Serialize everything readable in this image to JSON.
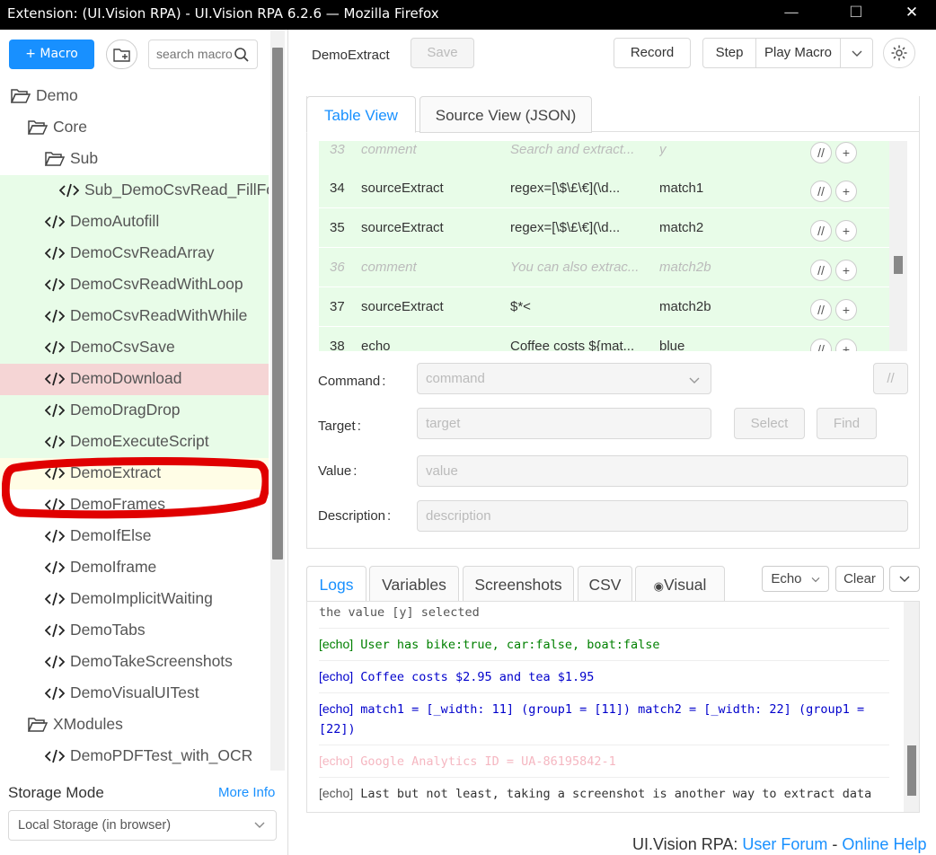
{
  "window": {
    "title": "Extension: (UI.Vision RPA) - UI.Vision RPA 6.2.6 — Mozilla Firefox",
    "minimize_glyph": "—",
    "maximize_glyph": "☐",
    "close_glyph": "✕"
  },
  "sidebar": {
    "new_macro_label": "+ Macro",
    "search_placeholder": "search macro",
    "tree": [
      {
        "label": "Demo",
        "type": "folder",
        "level": 0,
        "state": "normal"
      },
      {
        "label": "Core",
        "type": "folder",
        "level": 1,
        "state": "normal"
      },
      {
        "label": "Sub",
        "type": "folder",
        "level": 2,
        "state": "normal"
      },
      {
        "label": "Sub_DemoCsvRead_FillForm",
        "type": "macro",
        "level": 3,
        "state": "success"
      },
      {
        "label": "DemoAutofill",
        "type": "macro",
        "level": 2,
        "state": "success"
      },
      {
        "label": "DemoCsvReadArray",
        "type": "macro",
        "level": 2,
        "state": "success"
      },
      {
        "label": "DemoCsvReadWithLoop",
        "type": "macro",
        "level": 2,
        "state": "success"
      },
      {
        "label": "DemoCsvReadWithWhile",
        "type": "macro",
        "level": 2,
        "state": "success"
      },
      {
        "label": "DemoCsvSave",
        "type": "macro",
        "level": 2,
        "state": "success"
      },
      {
        "label": "DemoDownload",
        "type": "macro",
        "level": 2,
        "state": "error"
      },
      {
        "label": "DemoDragDrop",
        "type": "macro",
        "level": 2,
        "state": "success"
      },
      {
        "label": "DemoExecuteScript",
        "type": "macro",
        "level": 2,
        "state": "success"
      },
      {
        "label": "DemoExtract",
        "type": "macro",
        "level": 2,
        "state": "selected"
      },
      {
        "label": "DemoFrames",
        "type": "macro",
        "level": 2,
        "state": "normal"
      },
      {
        "label": "DemoIfElse",
        "type": "macro",
        "level": 2,
        "state": "normal"
      },
      {
        "label": "DemoIframe",
        "type": "macro",
        "level": 2,
        "state": "normal"
      },
      {
        "label": "DemoImplicitWaiting",
        "type": "macro",
        "level": 2,
        "state": "normal"
      },
      {
        "label": "DemoTabs",
        "type": "macro",
        "level": 2,
        "state": "normal"
      },
      {
        "label": "DemoTakeScreenshots",
        "type": "macro",
        "level": 2,
        "state": "normal"
      },
      {
        "label": "DemoVisualUITest",
        "type": "macro",
        "level": 2,
        "state": "normal"
      },
      {
        "label": "XModules",
        "type": "folder",
        "level": 1,
        "state": "normal"
      },
      {
        "label": "DemoPDFTest_with_OCR",
        "type": "macro",
        "level": 2,
        "state": "normal"
      }
    ],
    "storage_mode_label": "Storage Mode",
    "more_info_label": "More Info",
    "storage_selected": "Local Storage (in browser)"
  },
  "toolbar": {
    "macro_name": "DemoExtract",
    "save_label": "Save",
    "record_label": "Record",
    "step_label": "Step",
    "play_label": "Play Macro"
  },
  "editor": {
    "tabs": [
      "Table View",
      "Source View (JSON)"
    ],
    "rows": [
      {
        "num": "33",
        "command": "comment",
        "target": "Search and extract...",
        "value": "y",
        "is_comment": true
      },
      {
        "num": "34",
        "command": "sourceExtract",
        "target": "regex=[\\$\\£\\€](\\d...",
        "value": "match1",
        "is_comment": false
      },
      {
        "num": "35",
        "command": "sourceExtract",
        "target": "regex=[\\$\\£\\€](\\d...",
        "value": "match2",
        "is_comment": false
      },
      {
        "num": "36",
        "command": "comment",
        "target": "You can also extrac...",
        "value": "match2b",
        "is_comment": true
      },
      {
        "num": "37",
        "command": "sourceExtract",
        "target": "$*<",
        "value": "match2b",
        "is_comment": false
      },
      {
        "num": "38",
        "command": "echo",
        "target": "Coffee costs ${mat...",
        "value": "blue",
        "is_comment": false
      }
    ],
    "row_comment_btn": "//",
    "row_add_btn": "+",
    "command_label": "Command",
    "command_placeholder": "command",
    "comment_btn": "//",
    "target_label": "Target",
    "target_placeholder": "target",
    "select_label": "Select",
    "find_label": "Find",
    "value_label": "Value",
    "value_placeholder": "value",
    "description_label": "Description",
    "description_placeholder": "description",
    "label_colon": ":"
  },
  "logs": {
    "tabs": [
      "Logs",
      "Variables",
      "Screenshots",
      "CSV",
      "Visual"
    ],
    "echo_label": "Echo",
    "clear_label": "Clear",
    "entries": [
      {
        "tag": "",
        "text": "the value [y] selected",
        "color": "#555555"
      },
      {
        "tag": "[echo]",
        "text": "User has bike:true, car:false, boat:false",
        "color": "#008000"
      },
      {
        "tag": "[echo]",
        "text": "Coffee costs $2.95 and tea $1.95",
        "color": "#0000cc"
      },
      {
        "tag": "[echo]",
        "text": "match1 = [_width: 11] (group1 = [11]) match2 =  [_width: 22]  (group1 = [22])",
        "color": "#0000cc"
      },
      {
        "tag": "[echo]",
        "text": "Google Analytics ID = UA-86195842-1",
        "color": "#f5b7c1"
      },
      {
        "tag": "[echo]",
        "text": "Last but not least, taking a screenshot is another way to extract data",
        "color": "#333333"
      }
    ]
  },
  "footer": {
    "prefix": "UI.Vision RPA: ",
    "forum": "User Forum",
    "sep": " - ",
    "help": "Online Help"
  },
  "colors": {
    "accent": "#1890ff",
    "success_row": "#e8fce8",
    "error_row": "#f5d5d5",
    "selected_row": "#fffde6",
    "annotation": "#e00000"
  }
}
